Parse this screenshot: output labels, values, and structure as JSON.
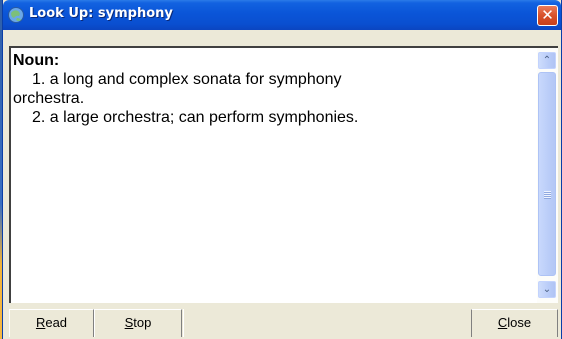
{
  "window": {
    "title": "Look Up: symphony",
    "close_glyph": "✕"
  },
  "content": {
    "part_of_speech": "Noun:",
    "definitions": [
      {
        "line1": "1. a long and complex sonata for symphony",
        "line2": "orchestra."
      },
      {
        "line1": "2. a large orchestra; can perform symphonies.",
        "line2": ""
      }
    ]
  },
  "scrollbar": {
    "up_glyph": "⌃",
    "down_glyph": "⌄"
  },
  "buttons": {
    "read": {
      "first": "R",
      "rest": "ead"
    },
    "stop": {
      "first": "S",
      "rest": "top"
    },
    "close": {
      "first": "C",
      "rest": "lose"
    }
  },
  "colors": {
    "titlebar": "#0a55d8",
    "close_button": "#d8522b",
    "face": "#ece9d8"
  }
}
